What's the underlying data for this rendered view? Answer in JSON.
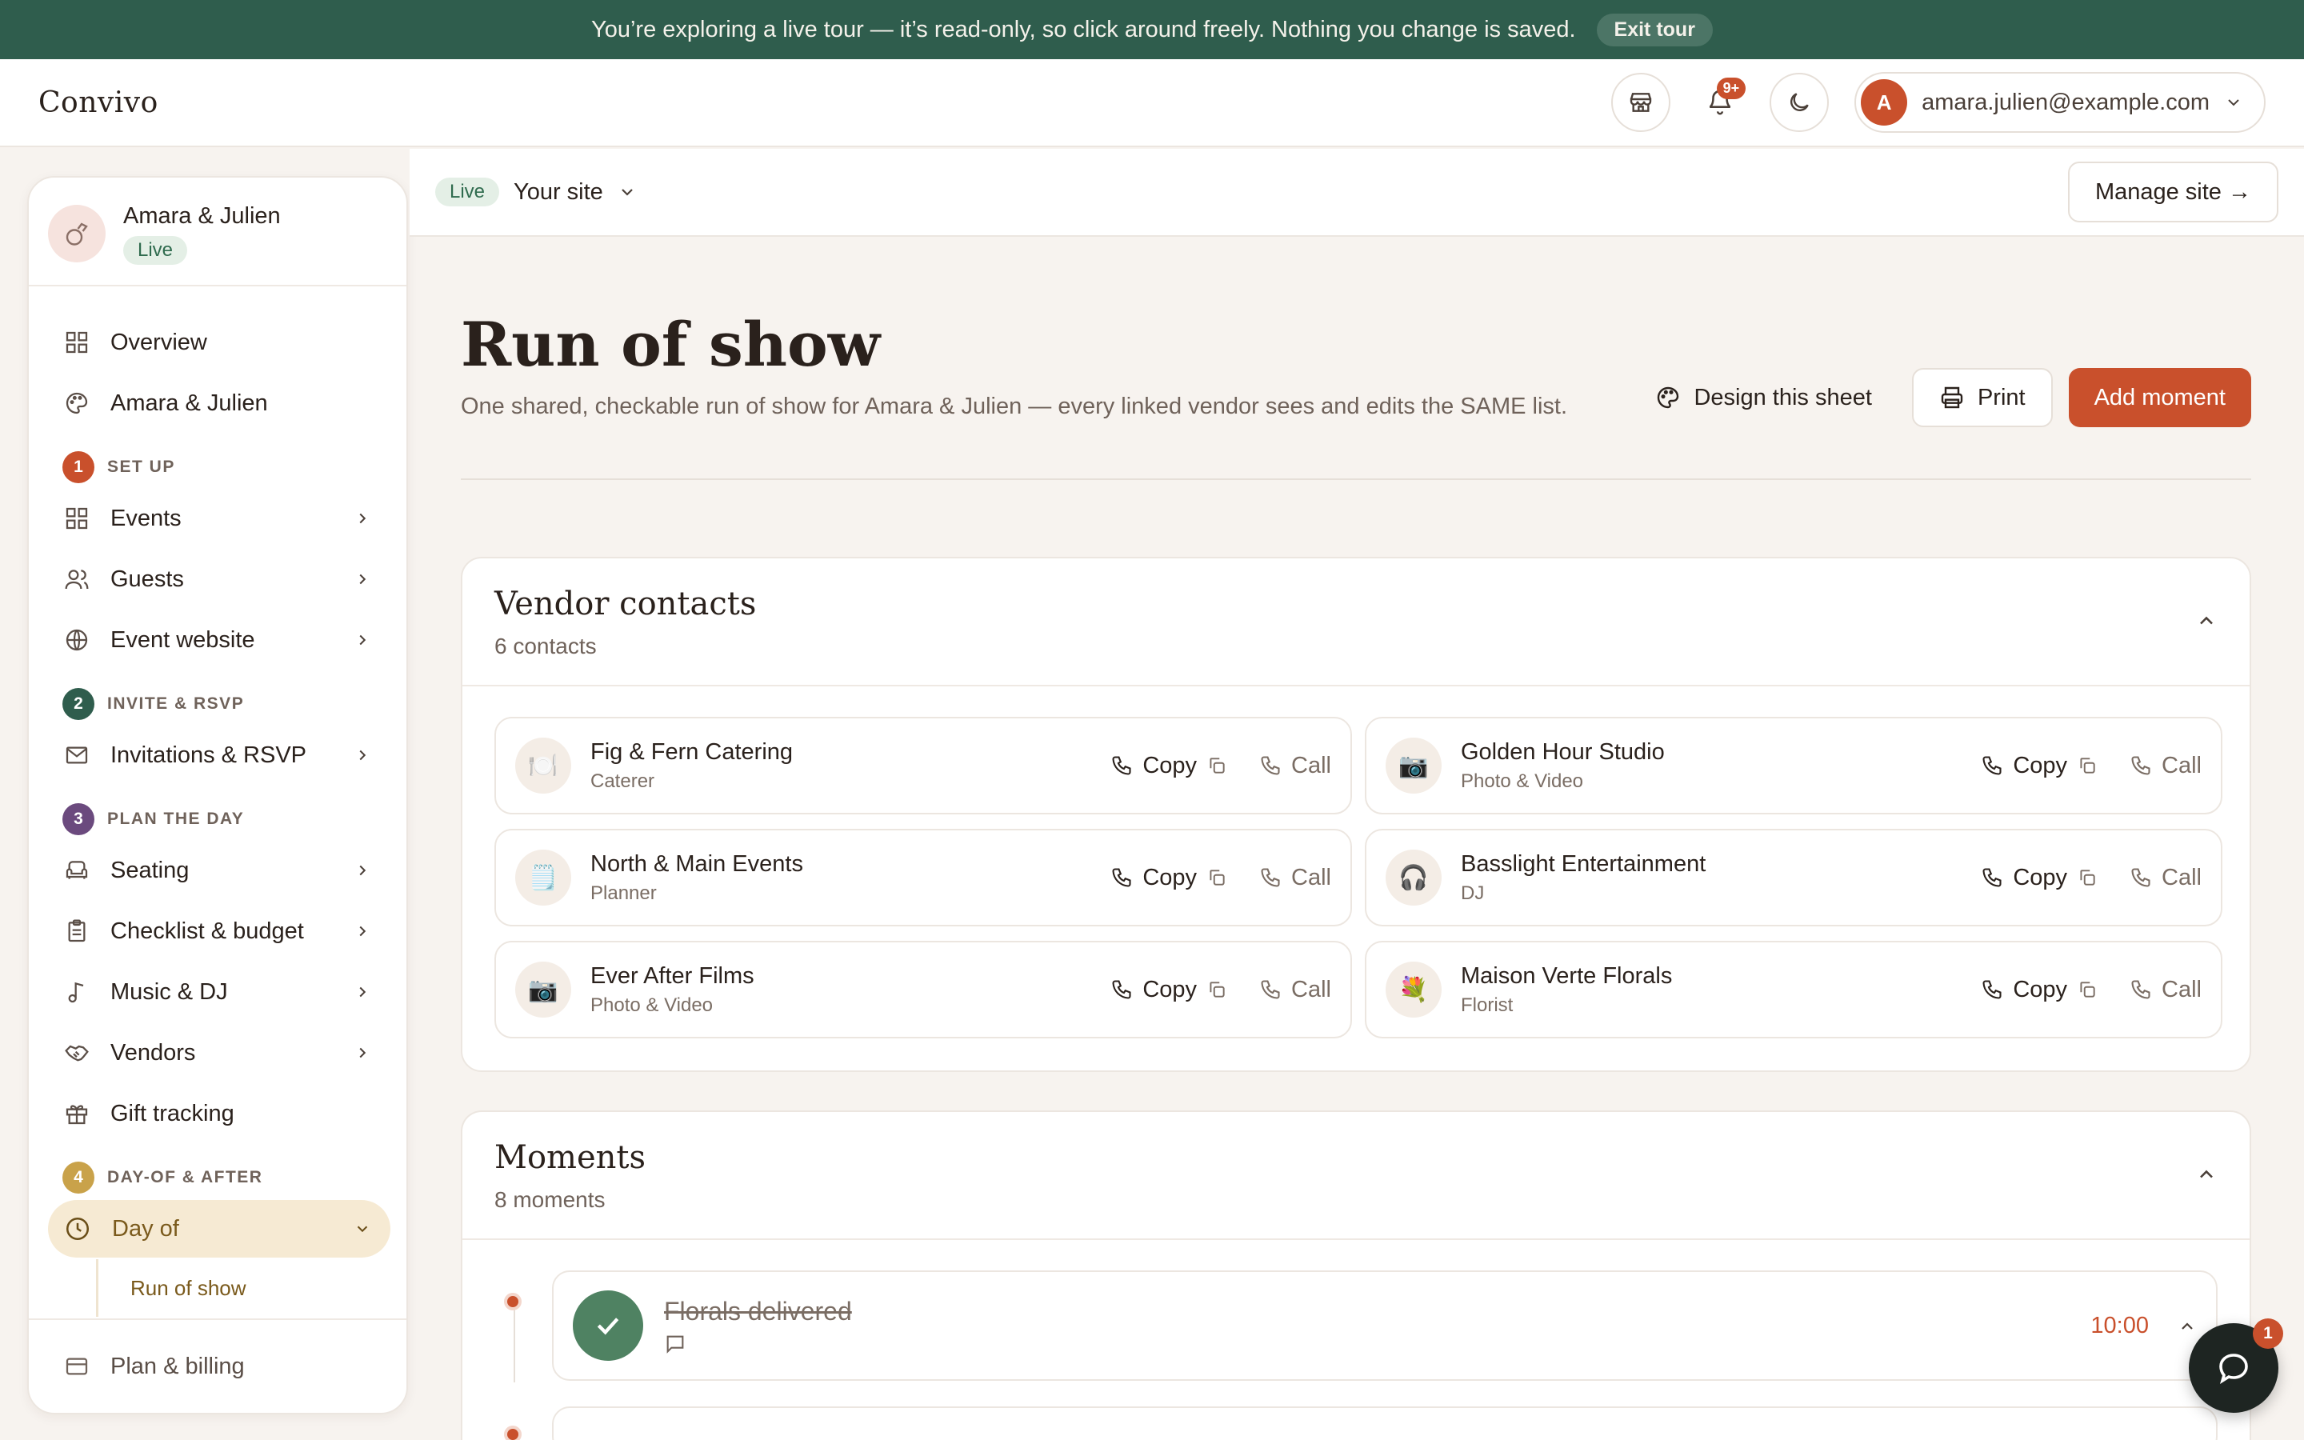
{
  "banner": {
    "message": "You’re exploring a live tour — it’s read-only, so click around freely. Nothing you change is saved.",
    "exit_label": "Exit tour"
  },
  "header": {
    "brand": "Convivo",
    "notifications_badge": "9+",
    "user_initial": "A",
    "user_email": "amara.julien@example.com"
  },
  "sidebar": {
    "couple_name": "Amara & Julien",
    "status": "Live",
    "items": {
      "overview": "Overview",
      "amara_julien": "Amara & Julien",
      "events": "Events",
      "guests": "Guests",
      "event_website": "Event website",
      "invitations": "Invitations & RSVP",
      "seating": "Seating",
      "checklist": "Checklist & budget",
      "music": "Music & DJ",
      "vendors": "Vendors",
      "gifts": "Gift tracking",
      "day_of": "Day of",
      "run_of_show": "Run of show",
      "billing": "Plan & billing"
    },
    "sections": [
      {
        "num": "1",
        "label": "SET UP",
        "color": "#c9502c"
      },
      {
        "num": "2",
        "label": "INVITE & RSVP",
        "color": "#2f5d4d"
      },
      {
        "num": "3",
        "label": "PLAN THE DAY",
        "color": "#6b4a7e"
      },
      {
        "num": "4",
        "label": "DAY-OF & AFTER",
        "color": "#c9a24a"
      }
    ]
  },
  "subheader": {
    "status": "Live",
    "site_label": "Your site",
    "manage_label": "Manage site →"
  },
  "main": {
    "title": "Run of show",
    "description": "One shared, checkable run of show for Amara & Julien — every linked vendor sees and edits the SAME list.",
    "design_label": "Design this sheet",
    "print_label": "Print",
    "add_label": "Add moment"
  },
  "vendor_contacts": {
    "title": "Vendor contacts",
    "count": "6 contacts",
    "copy_label": "Copy",
    "call_label": "Call",
    "vendors": [
      {
        "name": "Fig & Fern Catering",
        "role": "Caterer",
        "icon": "🍽️"
      },
      {
        "name": "Golden Hour Studio",
        "role": "Photo & Video",
        "icon": "📷"
      },
      {
        "name": "North & Main Events",
        "role": "Planner",
        "icon": "🗒️"
      },
      {
        "name": "Basslight Entertainment",
        "role": "DJ",
        "icon": "🎧"
      },
      {
        "name": "Ever After Films",
        "role": "Photo & Video",
        "icon": "📷"
      },
      {
        "name": "Maison Verte Florals",
        "role": "Florist",
        "icon": "💐"
      }
    ]
  },
  "moments": {
    "title": "Moments",
    "count": "8 moments",
    "items": [
      {
        "title": "Florals delivered",
        "time": "10:00",
        "done": true
      }
    ]
  },
  "chat": {
    "badge": "1"
  },
  "colors": {
    "accent": "#c9502c",
    "banner": "#2f5d4d",
    "background": "#f7f3ef"
  }
}
